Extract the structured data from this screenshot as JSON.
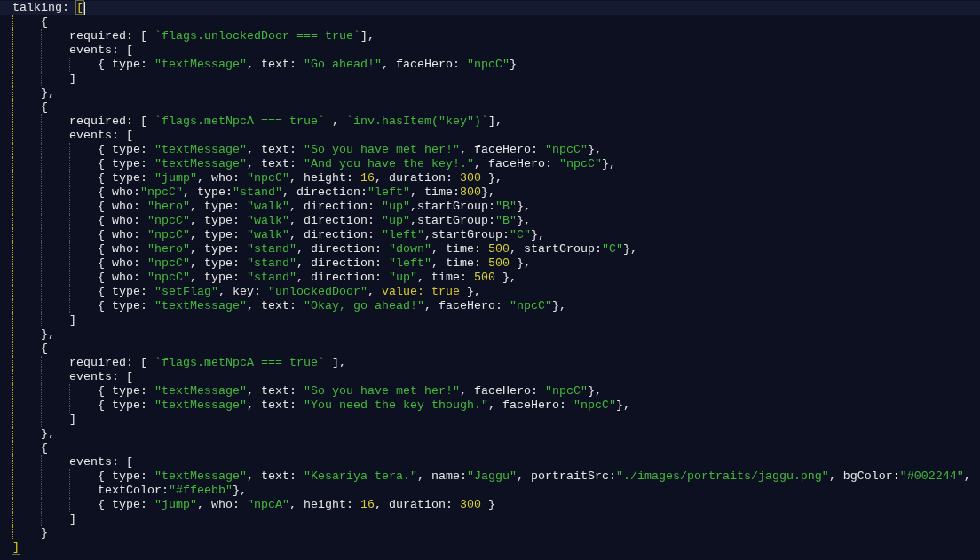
{
  "editor": {
    "lines": [
      {
        "current": true,
        "segments": [
          {
            "kind": "plain",
            "text": "talking: "
          },
          {
            "kind": "bracket",
            "text": "["
          }
        ]
      },
      {
        "current": false,
        "segments": [
          {
            "kind": "plain",
            "text": "    {"
          }
        ]
      },
      {
        "current": false,
        "segments": [
          {
            "kind": "plain",
            "text": "        required: [ "
          },
          {
            "kind": "string",
            "text": "`flags.unlockedDoor === true`"
          },
          {
            "kind": "plain",
            "text": "],"
          }
        ]
      },
      {
        "current": false,
        "segments": [
          {
            "kind": "plain",
            "text": "        events: ["
          }
        ]
      },
      {
        "current": false,
        "segments": [
          {
            "kind": "plain",
            "text": "            { type: "
          },
          {
            "kind": "string",
            "text": "\"textMessage\""
          },
          {
            "kind": "plain",
            "text": ", text: "
          },
          {
            "kind": "string",
            "text": "\"Go ahead!\""
          },
          {
            "kind": "plain",
            "text": ", faceHero: "
          },
          {
            "kind": "string",
            "text": "\"npcC\""
          },
          {
            "kind": "plain",
            "text": "}"
          }
        ]
      },
      {
        "current": false,
        "segments": [
          {
            "kind": "plain",
            "text": "        ]"
          }
        ]
      },
      {
        "current": false,
        "segments": [
          {
            "kind": "plain",
            "text": "    },"
          }
        ]
      },
      {
        "current": false,
        "segments": [
          {
            "kind": "plain",
            "text": "    {"
          }
        ]
      },
      {
        "current": false,
        "segments": [
          {
            "kind": "plain",
            "text": "        required: [ "
          },
          {
            "kind": "string",
            "text": "`flags.metNpcA === true`"
          },
          {
            "kind": "plain",
            "text": " , "
          },
          {
            "kind": "string",
            "text": "`inv.hasItem(\"key\")`"
          },
          {
            "kind": "plain",
            "text": "],"
          }
        ]
      },
      {
        "current": false,
        "segments": [
          {
            "kind": "plain",
            "text": "        events: ["
          }
        ]
      },
      {
        "current": false,
        "segments": [
          {
            "kind": "plain",
            "text": "            { type: "
          },
          {
            "kind": "string",
            "text": "\"textMessage\""
          },
          {
            "kind": "plain",
            "text": ", text: "
          },
          {
            "kind": "string",
            "text": "\"So you have met her!\""
          },
          {
            "kind": "plain",
            "text": ", faceHero: "
          },
          {
            "kind": "string",
            "text": "\"npcC\""
          },
          {
            "kind": "plain",
            "text": "},"
          }
        ]
      },
      {
        "current": false,
        "segments": [
          {
            "kind": "plain",
            "text": "            { type: "
          },
          {
            "kind": "string",
            "text": "\"textMessage\""
          },
          {
            "kind": "plain",
            "text": ", text: "
          },
          {
            "kind": "string",
            "text": "\"And you have the key!.\""
          },
          {
            "kind": "plain",
            "text": ", faceHero: "
          },
          {
            "kind": "string",
            "text": "\"npcC\""
          },
          {
            "kind": "plain",
            "text": "},"
          }
        ]
      },
      {
        "current": false,
        "segments": [
          {
            "kind": "plain",
            "text": "            { type: "
          },
          {
            "kind": "string",
            "text": "\"jump\""
          },
          {
            "kind": "plain",
            "text": ", who: "
          },
          {
            "kind": "string",
            "text": "\"npcC\""
          },
          {
            "kind": "plain",
            "text": ", height: "
          },
          {
            "kind": "number",
            "text": "16"
          },
          {
            "kind": "plain",
            "text": ", duration: "
          },
          {
            "kind": "number",
            "text": "300"
          },
          {
            "kind": "plain",
            "text": " },"
          }
        ]
      },
      {
        "current": false,
        "segments": [
          {
            "kind": "plain",
            "text": "            { who:"
          },
          {
            "kind": "string",
            "text": "\"npcC\""
          },
          {
            "kind": "plain",
            "text": ", type:"
          },
          {
            "kind": "string",
            "text": "\"stand\""
          },
          {
            "kind": "plain",
            "text": ", direction:"
          },
          {
            "kind": "string",
            "text": "\"left\""
          },
          {
            "kind": "plain",
            "text": ", time:"
          },
          {
            "kind": "number",
            "text": "800"
          },
          {
            "kind": "plain",
            "text": "},"
          }
        ]
      },
      {
        "current": false,
        "segments": [
          {
            "kind": "plain",
            "text": "            { who: "
          },
          {
            "kind": "string",
            "text": "\"hero\""
          },
          {
            "kind": "plain",
            "text": ", type: "
          },
          {
            "kind": "string",
            "text": "\"walk\""
          },
          {
            "kind": "plain",
            "text": ", direction: "
          },
          {
            "kind": "string",
            "text": "\"up\""
          },
          {
            "kind": "plain",
            "text": ",startGroup:"
          },
          {
            "kind": "string",
            "text": "\"B\""
          },
          {
            "kind": "plain",
            "text": "},"
          }
        ]
      },
      {
        "current": false,
        "segments": [
          {
            "kind": "plain",
            "text": "            { who: "
          },
          {
            "kind": "string",
            "text": "\"npcC\""
          },
          {
            "kind": "plain",
            "text": ", type: "
          },
          {
            "kind": "string",
            "text": "\"walk\""
          },
          {
            "kind": "plain",
            "text": ", direction: "
          },
          {
            "kind": "string",
            "text": "\"up\""
          },
          {
            "kind": "plain",
            "text": ",startGroup:"
          },
          {
            "kind": "string",
            "text": "\"B\""
          },
          {
            "kind": "plain",
            "text": "},"
          }
        ]
      },
      {
        "current": false,
        "segments": [
          {
            "kind": "plain",
            "text": "            { who: "
          },
          {
            "kind": "string",
            "text": "\"npcC\""
          },
          {
            "kind": "plain",
            "text": ", type: "
          },
          {
            "kind": "string",
            "text": "\"walk\""
          },
          {
            "kind": "plain",
            "text": ", direction: "
          },
          {
            "kind": "string",
            "text": "\"left\""
          },
          {
            "kind": "plain",
            "text": ",startGroup:"
          },
          {
            "kind": "string",
            "text": "\"C\""
          },
          {
            "kind": "plain",
            "text": "},"
          }
        ]
      },
      {
        "current": false,
        "segments": [
          {
            "kind": "plain",
            "text": "            { who: "
          },
          {
            "kind": "string",
            "text": "\"hero\""
          },
          {
            "kind": "plain",
            "text": ", type: "
          },
          {
            "kind": "string",
            "text": "\"stand\""
          },
          {
            "kind": "plain",
            "text": ", direction: "
          },
          {
            "kind": "string",
            "text": "\"down\""
          },
          {
            "kind": "plain",
            "text": ", time: "
          },
          {
            "kind": "number",
            "text": "500"
          },
          {
            "kind": "plain",
            "text": ", startGroup:"
          },
          {
            "kind": "string",
            "text": "\"C\""
          },
          {
            "kind": "plain",
            "text": "},"
          }
        ]
      },
      {
        "current": false,
        "segments": [
          {
            "kind": "plain",
            "text": "            { who: "
          },
          {
            "kind": "string",
            "text": "\"npcC\""
          },
          {
            "kind": "plain",
            "text": ", type: "
          },
          {
            "kind": "string",
            "text": "\"stand\""
          },
          {
            "kind": "plain",
            "text": ", direction: "
          },
          {
            "kind": "string",
            "text": "\"left\""
          },
          {
            "kind": "plain",
            "text": ", time: "
          },
          {
            "kind": "number",
            "text": "500"
          },
          {
            "kind": "plain",
            "text": " },"
          }
        ]
      },
      {
        "current": false,
        "segments": [
          {
            "kind": "plain",
            "text": "            { who: "
          },
          {
            "kind": "string",
            "text": "\"npcC\""
          },
          {
            "kind": "plain",
            "text": ", type: "
          },
          {
            "kind": "string",
            "text": "\"stand\""
          },
          {
            "kind": "plain",
            "text": ", direction: "
          },
          {
            "kind": "string",
            "text": "\"up\""
          },
          {
            "kind": "plain",
            "text": ", time: "
          },
          {
            "kind": "number",
            "text": "500"
          },
          {
            "kind": "plain",
            "text": " },"
          }
        ]
      },
      {
        "current": false,
        "segments": [
          {
            "kind": "plain",
            "text": "            { type: "
          },
          {
            "kind": "string",
            "text": "\"setFlag\""
          },
          {
            "kind": "plain",
            "text": ", key: "
          },
          {
            "kind": "string",
            "text": "\"unlockedDoor\""
          },
          {
            "kind": "plain",
            "text": ", "
          },
          {
            "kind": "keyword",
            "text": "value: true"
          },
          {
            "kind": "plain",
            "text": " },"
          }
        ]
      },
      {
        "current": false,
        "segments": [
          {
            "kind": "plain",
            "text": "            { type: "
          },
          {
            "kind": "string",
            "text": "\"textMessage\""
          },
          {
            "kind": "plain",
            "text": ", text: "
          },
          {
            "kind": "string",
            "text": "\"Okay, go ahead!\""
          },
          {
            "kind": "plain",
            "text": ", faceHero: "
          },
          {
            "kind": "string",
            "text": "\"npcC\""
          },
          {
            "kind": "plain",
            "text": "},"
          }
        ]
      },
      {
        "current": false,
        "segments": [
          {
            "kind": "plain",
            "text": "        ]"
          }
        ]
      },
      {
        "current": false,
        "segments": [
          {
            "kind": "plain",
            "text": "    },"
          }
        ]
      },
      {
        "current": false,
        "segments": [
          {
            "kind": "plain",
            "text": "    {"
          }
        ]
      },
      {
        "current": false,
        "segments": [
          {
            "kind": "plain",
            "text": "        required: [ "
          },
          {
            "kind": "string",
            "text": "`flags.metNpcA === true`"
          },
          {
            "kind": "plain",
            "text": " ],"
          }
        ]
      },
      {
        "current": false,
        "segments": [
          {
            "kind": "plain",
            "text": "        events: ["
          }
        ]
      },
      {
        "current": false,
        "segments": [
          {
            "kind": "plain",
            "text": "            { type: "
          },
          {
            "kind": "string",
            "text": "\"textMessage\""
          },
          {
            "kind": "plain",
            "text": ", text: "
          },
          {
            "kind": "string",
            "text": "\"So you have met her!\""
          },
          {
            "kind": "plain",
            "text": ", faceHero: "
          },
          {
            "kind": "string",
            "text": "\"npcC\""
          },
          {
            "kind": "plain",
            "text": "},"
          }
        ]
      },
      {
        "current": false,
        "segments": [
          {
            "kind": "plain",
            "text": "            { type: "
          },
          {
            "kind": "string",
            "text": "\"textMessage\""
          },
          {
            "kind": "plain",
            "text": ", text: "
          },
          {
            "kind": "string",
            "text": "\"You need the key though.\""
          },
          {
            "kind": "plain",
            "text": ", faceHero: "
          },
          {
            "kind": "string",
            "text": "\"npcC\""
          },
          {
            "kind": "plain",
            "text": "},"
          }
        ]
      },
      {
        "current": false,
        "segments": [
          {
            "kind": "plain",
            "text": "        ]"
          }
        ]
      },
      {
        "current": false,
        "segments": [
          {
            "kind": "plain",
            "text": "    },"
          }
        ]
      },
      {
        "current": false,
        "segments": [
          {
            "kind": "plain",
            "text": "    {"
          }
        ]
      },
      {
        "current": false,
        "segments": [
          {
            "kind": "plain",
            "text": "        events: ["
          }
        ]
      },
      {
        "current": false,
        "segments": [
          {
            "kind": "plain",
            "text": "            { type: "
          },
          {
            "kind": "string",
            "text": "\"textMessage\""
          },
          {
            "kind": "plain",
            "text": ", text: "
          },
          {
            "kind": "string",
            "text": "\"Kesariya tera.\""
          },
          {
            "kind": "plain",
            "text": ", name:"
          },
          {
            "kind": "string",
            "text": "\"Jaggu\""
          },
          {
            "kind": "plain",
            "text": ", portraitSrc:"
          },
          {
            "kind": "string",
            "text": "\"./images/portraits/jaggu.png\""
          },
          {
            "kind": "plain",
            "text": ", bgColor:"
          },
          {
            "kind": "string",
            "text": "\"#002244\""
          },
          {
            "kind": "plain",
            "text": ","
          }
        ]
      },
      {
        "current": false,
        "segments": [
          {
            "kind": "plain",
            "text": "            textColor:"
          },
          {
            "kind": "string",
            "text": "\"#ffeebb\""
          },
          {
            "kind": "plain",
            "text": "},"
          }
        ]
      },
      {
        "current": false,
        "segments": [
          {
            "kind": "plain",
            "text": "            { type: "
          },
          {
            "kind": "string",
            "text": "\"jump\""
          },
          {
            "kind": "plain",
            "text": ", who: "
          },
          {
            "kind": "string",
            "text": "\"npcA\""
          },
          {
            "kind": "plain",
            "text": ", height: "
          },
          {
            "kind": "number",
            "text": "16"
          },
          {
            "kind": "plain",
            "text": ", duration: "
          },
          {
            "kind": "number",
            "text": "300"
          },
          {
            "kind": "plain",
            "text": " }"
          }
        ]
      },
      {
        "current": false,
        "segments": [
          {
            "kind": "plain",
            "text": "        ]"
          }
        ]
      },
      {
        "current": false,
        "segments": [
          {
            "kind": "plain",
            "text": "    }"
          }
        ]
      },
      {
        "current": false,
        "segments": [
          {
            "kind": "bracket",
            "text": "]"
          }
        ]
      }
    ]
  }
}
